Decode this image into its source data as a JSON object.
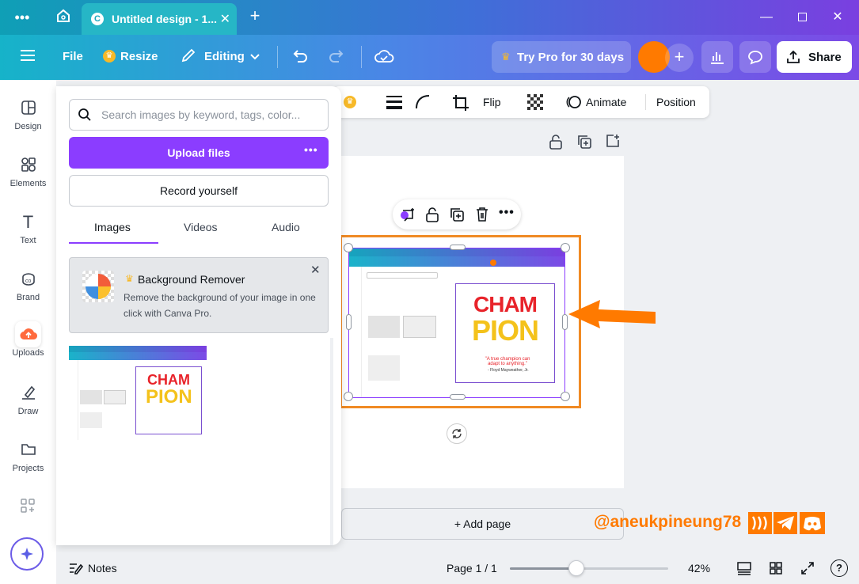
{
  "tabbar": {
    "tab_title": "Untitled design - 1...",
    "tab_icon": "C",
    "new_tab": "+"
  },
  "topbar": {
    "file": "File",
    "resize": "Resize",
    "editing": "Editing",
    "try_pro": "Try Pro for 30 days",
    "share": "Share"
  },
  "sidebar": {
    "items": [
      {
        "label": "Design",
        "icon": "design-icon"
      },
      {
        "label": "Elements",
        "icon": "elements-icon"
      },
      {
        "label": "Text",
        "icon": "text-icon"
      },
      {
        "label": "Brand",
        "icon": "brand-icon"
      },
      {
        "label": "Uploads",
        "icon": "upload-icon"
      },
      {
        "label": "Draw",
        "icon": "draw-icon"
      },
      {
        "label": "Projects",
        "icon": "folder-icon"
      }
    ]
  },
  "panel": {
    "search_placeholder": "Search images by keyword, tags, color...",
    "upload_files": "Upload files",
    "record_yourself": "Record yourself",
    "tabs": [
      "Images",
      "Videos",
      "Audio"
    ],
    "promo": {
      "title": "Background Remover",
      "body": "Remove the background of your image in one click with Canva Pro."
    }
  },
  "canvas_toolbar": {
    "flip": "Flip",
    "animate": "Animate",
    "position": "Position"
  },
  "mini": {
    "cham": "CHAM",
    "pion": "PION",
    "quote": "\"A true champion can adapt to anything.\"",
    "author": "- Floyd Mayweather, Jr."
  },
  "canvas": {
    "add_page": "+ Add page"
  },
  "watermark": "@aneukpineung78",
  "bottombar": {
    "notes": "Notes",
    "page": "Page 1 / 1",
    "zoom": "42%",
    "zoom_level": 0.42
  },
  "colors": {
    "accent": "#8b3dff",
    "orange": "#ff7a00",
    "selection": "#f08a24"
  }
}
